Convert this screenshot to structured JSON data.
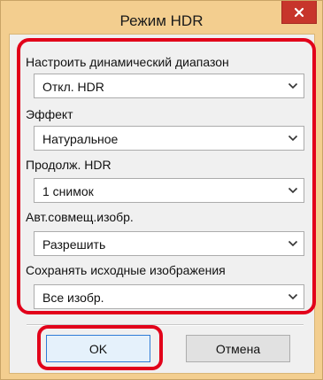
{
  "window": {
    "title": "Режим HDR",
    "close_icon": "close-icon"
  },
  "fields": [
    {
      "label": "Настроить динамический диапазон",
      "value": "Откл. HDR"
    },
    {
      "label": "Эффект",
      "value": "Натуральное"
    },
    {
      "label": "Продолж. HDR",
      "value": "1 снимок"
    },
    {
      "label": "Авт.совмещ.изобр.",
      "value": "Разрешить"
    },
    {
      "label": "Сохранять исходные изображения",
      "value": "Все изобр."
    }
  ],
  "buttons": {
    "ok_label": "OK",
    "cancel_label": "Отмена"
  },
  "colors": {
    "frame": "#f3ce8f",
    "close_button": "#c7352b",
    "highlight": "#e2001a"
  }
}
